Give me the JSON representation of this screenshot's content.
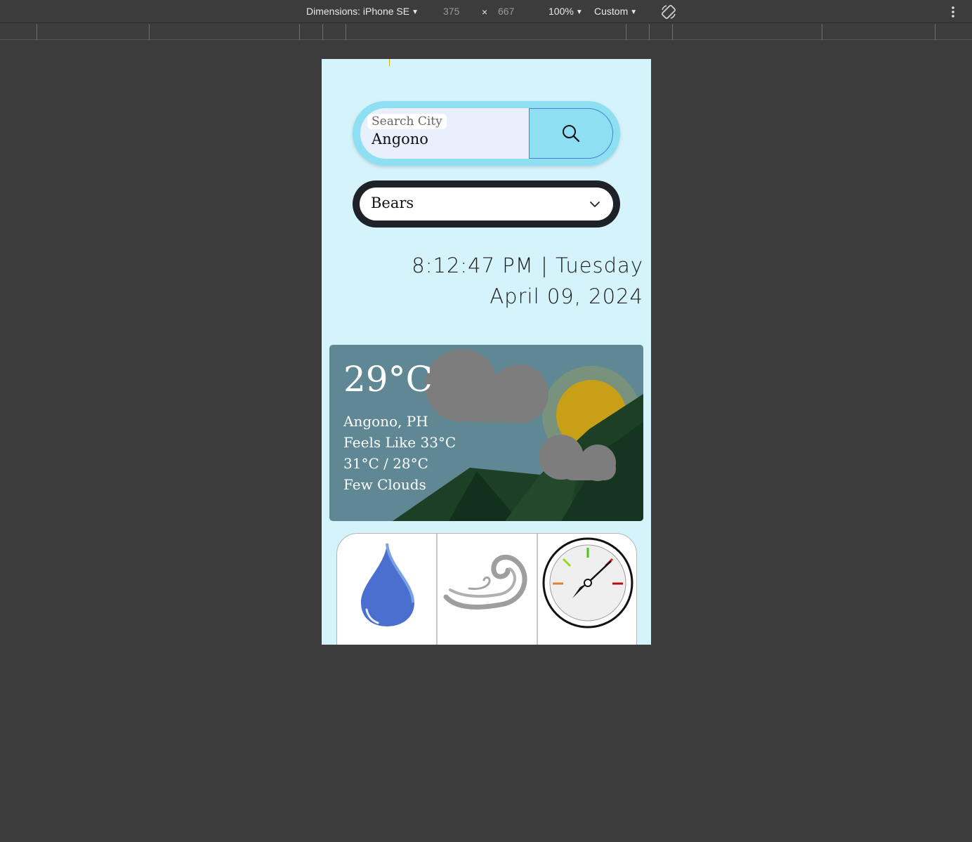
{
  "devtools": {
    "dimensions_label": "Dimensions: iPhone SE",
    "width_value": "375",
    "times": "×",
    "height_value": "667",
    "zoom": "100%",
    "throttle": "Custom"
  },
  "search": {
    "placeholder": "Search City",
    "value": "Angono"
  },
  "select": {
    "value": "Bears"
  },
  "datetime": {
    "time_line": "8:12:47 PM | Tuesday",
    "date_line": "April 09, 2024"
  },
  "weather": {
    "temperature": "29°C",
    "location": "Angono, PH",
    "feels_like": "Feels Like 33°C",
    "range": "31°C / 28°C",
    "condition": "Few Clouds"
  },
  "colors": {
    "viewport_bg": "#d5f3fb",
    "search_accent": "#8fdff3",
    "card_sky": "#5f8894",
    "sun": "#c7a017",
    "mountains": "#1d3f25"
  },
  "icons": [
    "rotate-icon",
    "kebab-icon",
    "search-icon",
    "chevron-down-icon",
    "sun-icon",
    "cloud-icon",
    "humidity-drop-icon",
    "wind-icon",
    "pressure-gauge-icon"
  ]
}
